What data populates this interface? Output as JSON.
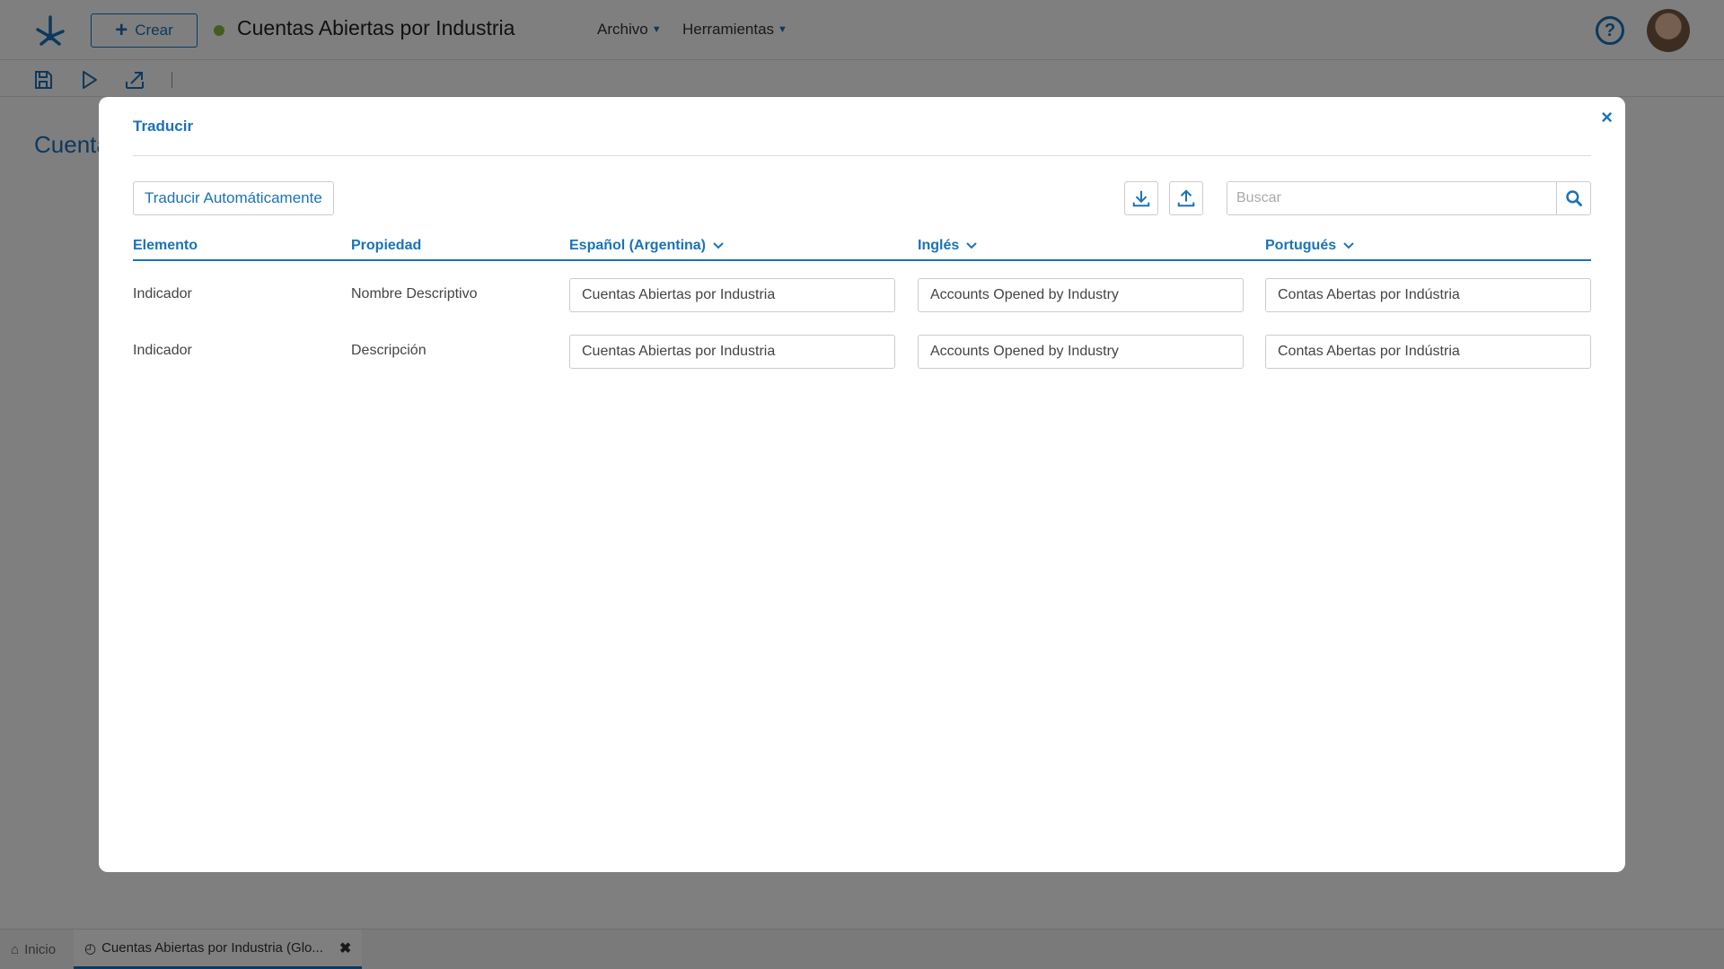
{
  "header": {
    "create_label": "Crear",
    "title": "Cuentas Abiertas por Industria",
    "menus": [
      {
        "label": "Archivo"
      },
      {
        "label": "Herramientas"
      }
    ],
    "status_color": "#8db640"
  },
  "background": {
    "page_title": "Cuenta"
  },
  "tabs": [
    {
      "label": "Inicio",
      "icon": "home-icon"
    },
    {
      "label": "Cuentas Abiertas por Industria (Glo...",
      "icon": "chart-icon",
      "active": true
    }
  ],
  "modal": {
    "title": "Traducir",
    "close": "×",
    "auto_translate_label": "Traducir Automáticamente",
    "search_placeholder": "Buscar",
    "columns": [
      {
        "label": "Elemento"
      },
      {
        "label": "Propiedad"
      },
      {
        "label": "Español (Argentina)"
      },
      {
        "label": "Inglés"
      },
      {
        "label": "Portugués"
      }
    ],
    "rows": [
      {
        "element": "Indicador",
        "property": "Nombre Descriptivo",
        "es": "Cuentas Abiertas por Industria",
        "en": "Accounts Opened by Industry",
        "pt": "Contas Abertas por Indústria"
      },
      {
        "element": "Indicador",
        "property": "Descripción",
        "es": "Cuentas Abiertas por Industria",
        "en": "Accounts Opened by Industry",
        "pt": "Contas Abertas por Indústria"
      }
    ]
  },
  "colors": {
    "accent": "#1a73b8",
    "overlay": "rgba(0,0,0,0.5)"
  }
}
